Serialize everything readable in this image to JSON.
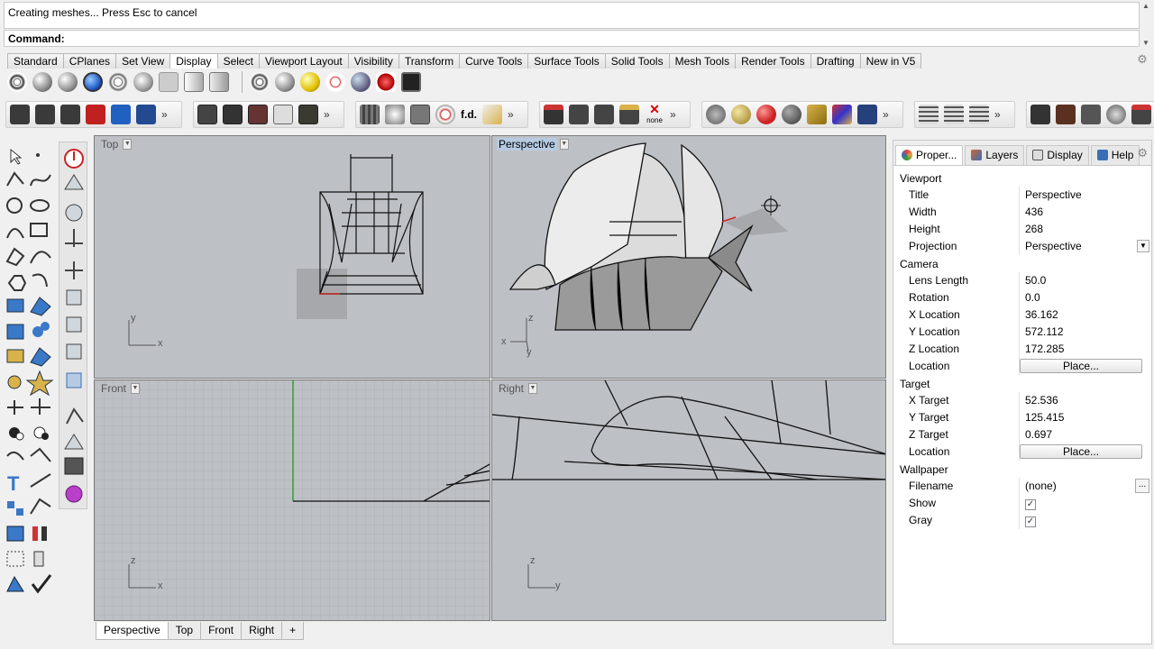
{
  "command": {
    "history": "Creating meshes... Press Esc to cancel",
    "prompt": "Command:"
  },
  "toolbar_tabs": [
    "Standard",
    "CPlanes",
    "Set View",
    "Display",
    "Select",
    "Viewport Layout",
    "Visibility",
    "Transform",
    "Curve Tools",
    "Surface Tools",
    "Solid Tools",
    "Mesh Tools",
    "Render Tools",
    "Drafting",
    "New in V5"
  ],
  "active_toolbar_tab": "Display",
  "toolbar_row2_text": {
    "fd": "f.d.",
    "none": "none"
  },
  "viewports": {
    "top": {
      "label": "Top"
    },
    "perspective": {
      "label": "Perspective"
    },
    "front": {
      "label": "Front"
    },
    "right": {
      "label": "Right"
    }
  },
  "axes": {
    "top": {
      "a": "y",
      "b": "x"
    },
    "perspective": {
      "a": "z",
      "b": "x",
      "c": "y"
    },
    "front": {
      "a": "z",
      "b": "x"
    },
    "right": {
      "a": "z",
      "b": "y"
    }
  },
  "viewport_tabs": [
    "Perspective",
    "Top",
    "Front",
    "Right"
  ],
  "viewport_tab_add": "+",
  "panel": {
    "tabs": [
      {
        "label": "Proper...",
        "color": "#d64545"
      },
      {
        "label": "Layers",
        "color": "#cc6633"
      },
      {
        "label": "Display",
        "color": "#555555"
      },
      {
        "label": "Help",
        "color": "#3a6fb5"
      }
    ],
    "sections": {
      "viewport": "Viewport",
      "camera": "Camera",
      "target": "Target",
      "wallpaper": "Wallpaper"
    },
    "viewport_rows": [
      {
        "key": "Title",
        "value": "Perspective"
      },
      {
        "key": "Width",
        "value": "436"
      },
      {
        "key": "Height",
        "value": "268"
      },
      {
        "key": "Projection",
        "value": "Perspective"
      }
    ],
    "camera_rows": [
      {
        "key": "Lens Length",
        "value": "50.0"
      },
      {
        "key": "Rotation",
        "value": "0.0"
      },
      {
        "key": "X Location",
        "value": "36.162"
      },
      {
        "key": "Y Location",
        "value": "572.112"
      },
      {
        "key": "Z Location",
        "value": "172.285"
      },
      {
        "key": "Location",
        "value": "Place..."
      }
    ],
    "target_rows": [
      {
        "key": "X Target",
        "value": "52.536"
      },
      {
        "key": "Y Target",
        "value": "125.415"
      },
      {
        "key": "Z Target",
        "value": "0.697"
      },
      {
        "key": "Location",
        "value": "Place..."
      }
    ],
    "wallpaper_rows": [
      {
        "key": "Filename",
        "value": "(none)"
      },
      {
        "key": "Show",
        "value": "✓"
      },
      {
        "key": "Gray",
        "value": "✓"
      }
    ]
  },
  "colors": {
    "viewport_bg": "#bdc1c6",
    "active_label": "#b6cbe1",
    "grid_line": "#a9adb2",
    "axis_green": "#2fa02f"
  }
}
